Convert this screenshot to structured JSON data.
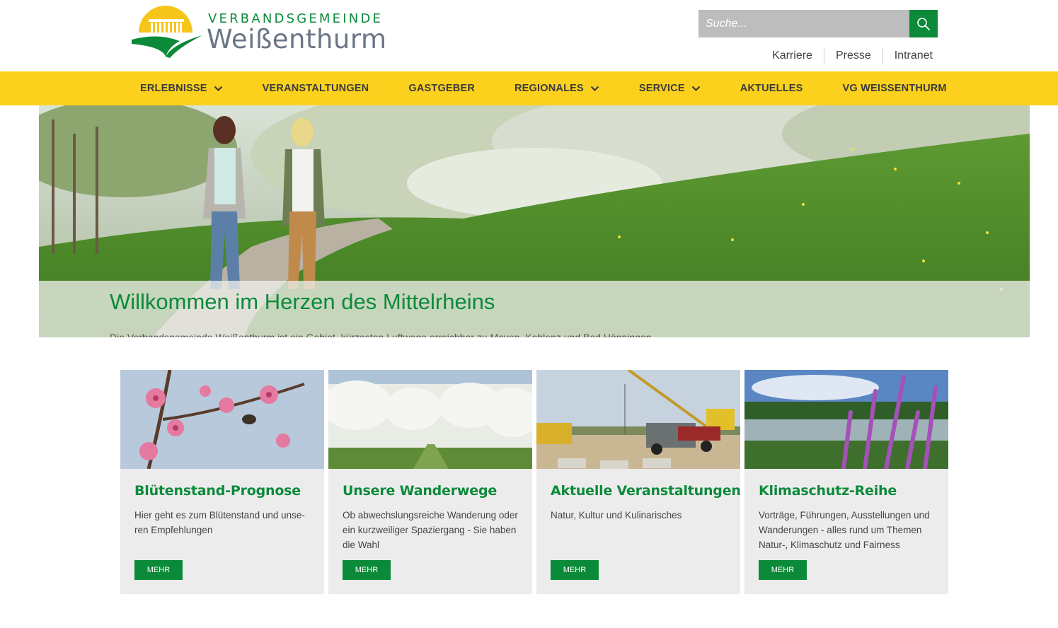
{
  "logo": {
    "top_text": "VERBANDSGEMEINDE",
    "main_text": "Weißenthurm"
  },
  "search": {
    "placeholder": "Suche...",
    "icon": "search-icon"
  },
  "top_links": [
    "Karriere",
    "Presse",
    "Intranet"
  ],
  "nav": [
    {
      "label": "ERLEBNISSE",
      "dropdown": true
    },
    {
      "label": "VERANSTALTUNGEN",
      "dropdown": false
    },
    {
      "label": "GASTGEBER",
      "dropdown": false
    },
    {
      "label": "REGIONALES",
      "dropdown": true
    },
    {
      "label": "SERVICE",
      "dropdown": true
    },
    {
      "label": "AKTUELLES",
      "dropdown": false
    },
    {
      "label": "VG WEISSENTHURM",
      "dropdown": false
    }
  ],
  "hero": {
    "title": "Willkommen im Herzen des Mittelrheins",
    "subtitle": "Die Verbandsgemeinde Weißenthurm ist ein Gebiet, kürzesten Luftwege erreichbar zu Mayen, Koblenz und Bad Hönningen"
  },
  "cards": [
    {
      "title": "Blütenstand-Prognose",
      "text": "Hier geht es zum Blütenstand und unse-ren Empfehlungen",
      "button": "MEHR"
    },
    {
      "title": "Unsere Wanderwege",
      "text": "Ob abwechslungsreiche Wanderung oder ein kurzweiliger Spaziergang - Sie haben die Wahl",
      "button": "MEHR"
    },
    {
      "title": "Aktuelle Veranstaltungen",
      "text": "Natur, Kultur und Kulinarisches",
      "button": "MEHR"
    },
    {
      "title": "Klimaschutz-Reihe",
      "text": "Vorträge, Führungen, Ausstellungen und Wanderungen - alles rund um Themen Natur-, Klimaschutz und Fairness",
      "button": "MEHR"
    }
  ],
  "colors": {
    "brand_green": "#0b8a3a",
    "nav_yellow": "#fcd11d",
    "search_gray": "#bdbdbd",
    "card_bg": "#ececec"
  }
}
